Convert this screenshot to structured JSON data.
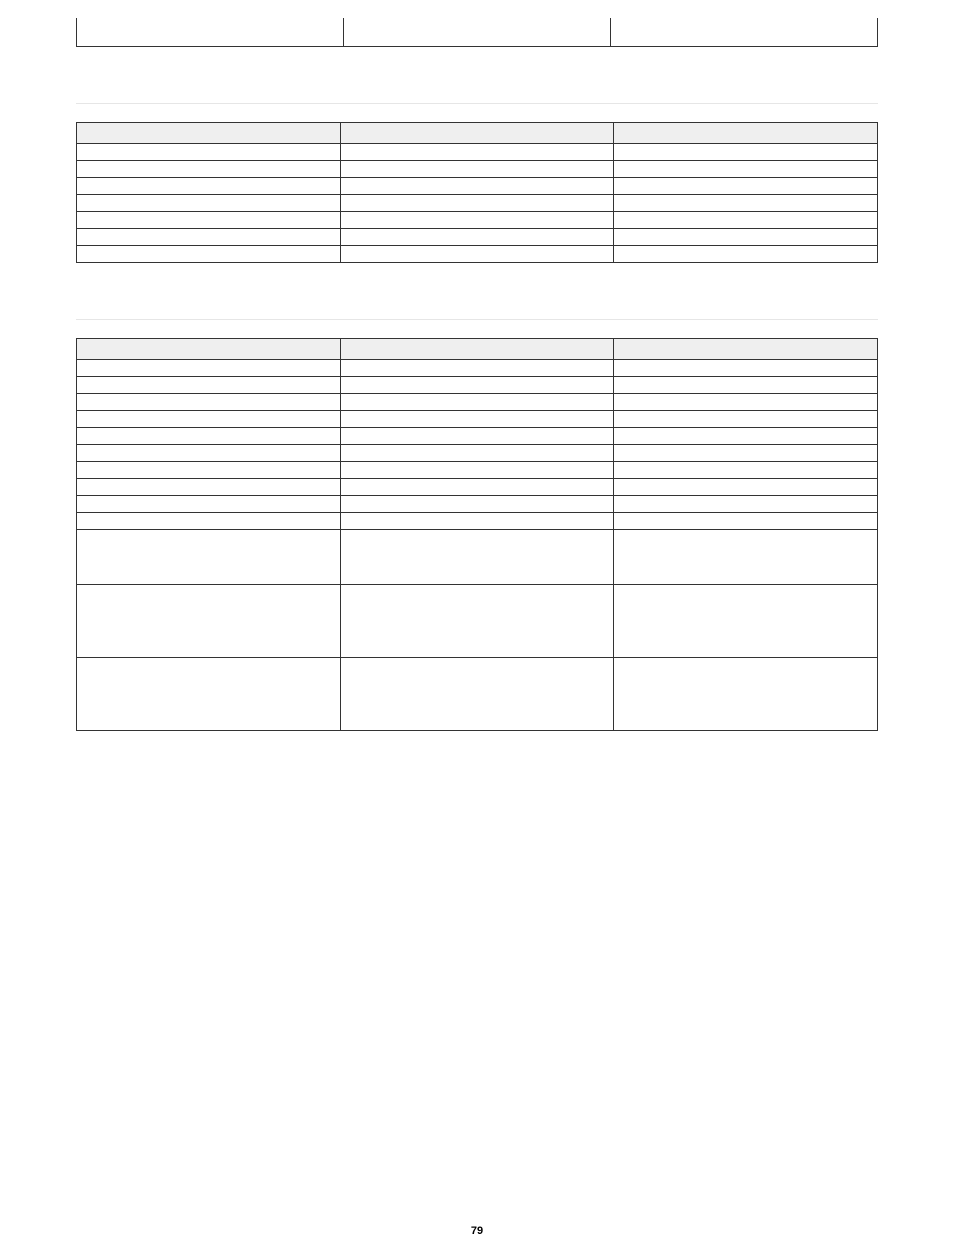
{
  "page_number": "79",
  "sections": [
    {
      "title": "",
      "desc": "",
      "headers": [
        "",
        "",
        ""
      ],
      "rows": [
        {
          "a": "",
          "b": "",
          "c": ""
        },
        {
          "a": "",
          "b": "",
          "c": ""
        },
        {
          "a": "",
          "b": "",
          "c": ""
        },
        {
          "a": "",
          "b": "",
          "c": ""
        },
        {
          "a": "",
          "b": "",
          "c": ""
        },
        {
          "a": "",
          "b": "",
          "c": ""
        },
        {
          "a": "",
          "b": "",
          "c": ""
        }
      ]
    },
    {
      "title": "",
      "desc": "",
      "headers": [
        "",
        "",
        ""
      ],
      "rows": [
        {
          "a": "",
          "b": "",
          "c": ""
        },
        {
          "a": "",
          "b": "",
          "c": ""
        },
        {
          "a": "",
          "b": "",
          "c": ""
        },
        {
          "a": "",
          "b": "",
          "c": ""
        },
        {
          "a": "",
          "b": "",
          "c": ""
        },
        {
          "a": "",
          "b": "",
          "c": ""
        },
        {
          "a": "",
          "b": "",
          "c": ""
        },
        {
          "a": "",
          "b": "",
          "c": ""
        },
        {
          "a": "",
          "b": "",
          "c": ""
        },
        {
          "a": "",
          "b": "",
          "c": ""
        },
        {
          "a": "",
          "b": "",
          "c": ""
        },
        {
          "a": "",
          "b": "",
          "c": ""
        },
        {
          "a": "",
          "b": "",
          "c": ""
        }
      ]
    }
  ]
}
